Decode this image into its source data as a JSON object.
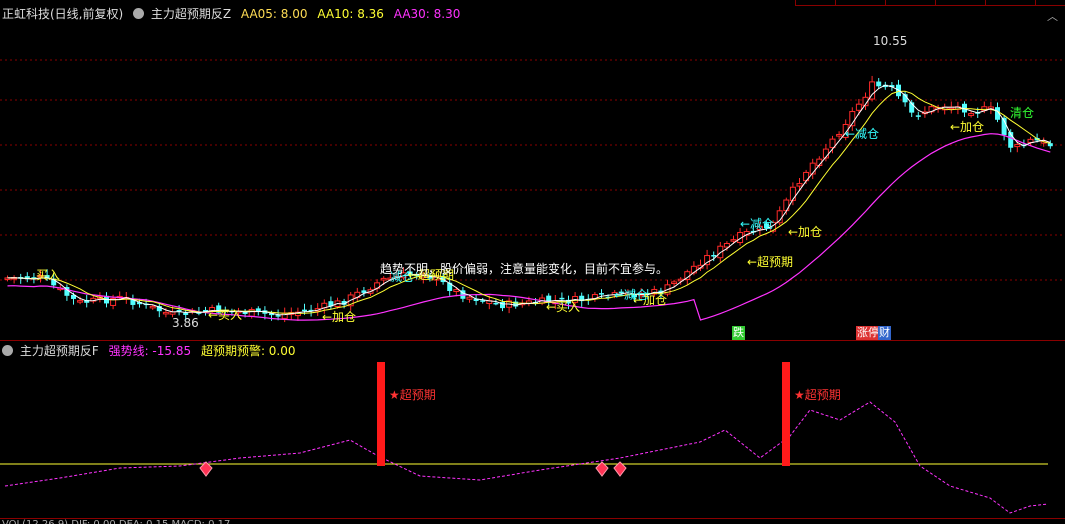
{
  "colors": {
    "up": "#ff2a2a",
    "down": "#54ffff",
    "ma5": "#ffffff",
    "ma10": "#ffff33",
    "ma30": "#ff33ff",
    "grid": "#8a0000",
    "cyan": "#33ffff",
    "warn": "#ffff33",
    "green": "#33ff33"
  },
  "main_panel": {
    "title": "正虹科技(日线,前复权)",
    "indicator": "主力超预期反Z",
    "ma5_label": "AA05: 8.00",
    "ma10_label": "AA10: 8.36",
    "ma30_label": "AA30: 8.30",
    "high_label": "10.55",
    "low_label": "3.86",
    "comment": "趋势不明，股价偏弱，注意量能变化，目前不宜参与。",
    "signals": {
      "buy1": "买入",
      "buy2": "←买入",
      "buy3": "←买入",
      "add1": "←加仓",
      "add2": "←加仓",
      "add3": "←加仓",
      "add4": "←加仓",
      "reduce1": "减仓",
      "reduce2": "←减仓",
      "reduce3": "←减仓",
      "reduce4": "←减仓",
      "clear": "清仓",
      "super1": "←超预期",
      "super2": "←超预期"
    },
    "markers": {
      "drop": "跌",
      "limitup": "涨停",
      "fin": "财"
    }
  },
  "sub_panel": {
    "indicator": "主力超预期反F",
    "strong_label": "强势线: -15.85",
    "warn_label": "超预期预警: 0.00",
    "super_label": "★超预期"
  },
  "bottom_panel": {
    "partial_text": "VOL(12,26,9)  DIF: 0.00  DEA: 0.15  MACD: 0.17"
  },
  "chart_data": [
    {
      "type": "candlestick",
      "title": "正虹科技(日线,前复权)",
      "series_names": [
        "AA05",
        "AA10",
        "AA30"
      ],
      "last_values": {
        "AA05": 8.0,
        "AA10": 8.36,
        "AA30": 8.3
      },
      "annotated_high": 10.55,
      "annotated_low": 3.86
    },
    {
      "type": "line",
      "title": "主力超预期反F",
      "series": [
        {
          "name": "强势线",
          "last": -15.85
        },
        {
          "name": "超预期预警",
          "last": 0.0
        }
      ]
    }
  ]
}
